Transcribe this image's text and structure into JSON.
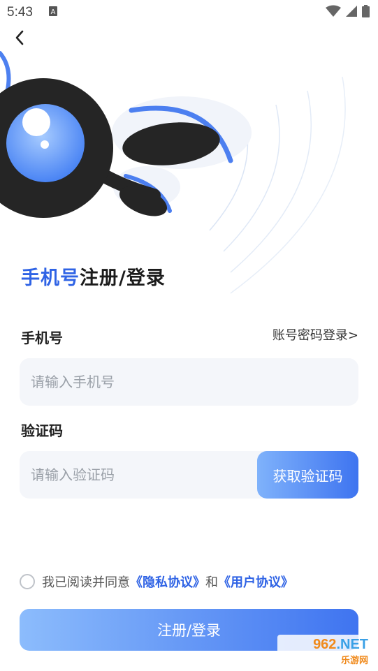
{
  "status_bar": {
    "time": "5:43"
  },
  "title": {
    "accent": "手机号",
    "rest": "注册/登录"
  },
  "phone": {
    "label": "手机号",
    "alt_login": "账号密码登录>",
    "placeholder": "请输入手机号"
  },
  "code": {
    "label": "验证码",
    "placeholder": "请输入验证码",
    "get_code_label": "获取验证码"
  },
  "agreement": {
    "prefix": "我已阅读并同意",
    "privacy": "《隐私协议》",
    "and": "和",
    "user": "《用户协议》"
  },
  "submit_label": "注册/登录",
  "watermark": {
    "top_num": "962",
    "top_net": ".NET",
    "bottom": "乐游网"
  },
  "colors": {
    "accent": "#2f63e5",
    "button_start": "#8cbcfc",
    "button_end": "#3f74f0"
  }
}
